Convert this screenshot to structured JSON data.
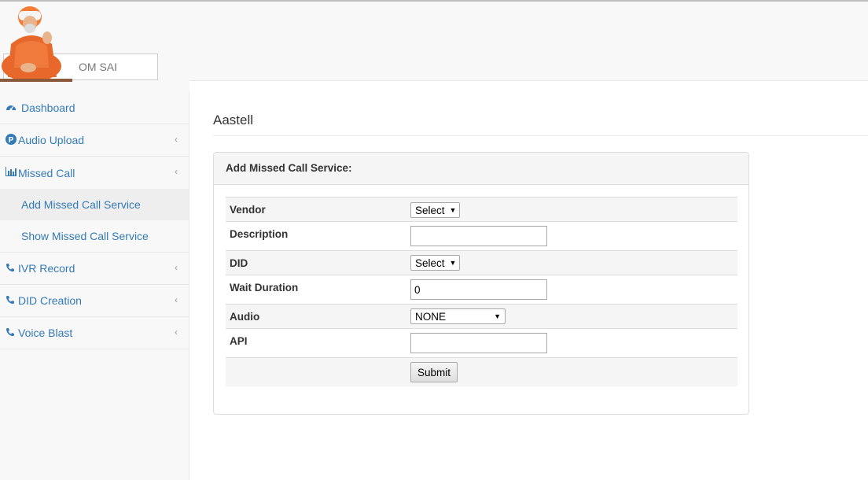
{
  "header": {
    "brand": "OM SAI"
  },
  "sidebar": {
    "items": [
      {
        "label": "Dashboard",
        "icon": "dashboard-icon",
        "has_chevron": false
      },
      {
        "label": "Audio Upload",
        "icon": "p-circle-icon",
        "has_chevron": true
      },
      {
        "label": "Missed Call",
        "icon": "bar-chart-icon",
        "has_chevron": true,
        "children": [
          "Add Missed Call Service",
          "Show Missed Call Service"
        ]
      },
      {
        "label": "IVR Record",
        "icon": "phone-icon",
        "has_chevron": true
      },
      {
        "label": "DID Creation",
        "icon": "phone-icon",
        "has_chevron": true
      },
      {
        "label": "Voice Blast",
        "icon": "phone-icon",
        "has_chevron": true
      }
    ],
    "active_child": "Add Missed Call Service"
  },
  "main": {
    "title": "Aastell",
    "panel_heading": "Add Missed Call Service:",
    "form": {
      "vendor": {
        "label": "Vendor",
        "value": "Select"
      },
      "description": {
        "label": "Description",
        "value": ""
      },
      "did": {
        "label": "DID",
        "value": "Select"
      },
      "wait_duration": {
        "label": "Wait Duration",
        "value": "0"
      },
      "audio": {
        "label": "Audio",
        "value": "NONE"
      },
      "api": {
        "label": "API",
        "value": ""
      },
      "submit_label": "Submit"
    }
  },
  "colors": {
    "link": "#337ab7",
    "panel_heading_bg": "#f5f5f5",
    "active_sub_bg": "#eeeeee",
    "logo_robe": "#e8672a"
  }
}
